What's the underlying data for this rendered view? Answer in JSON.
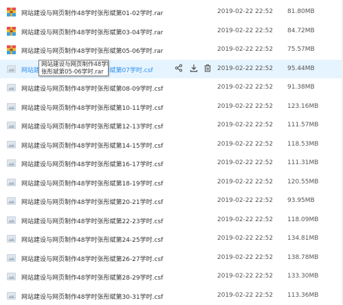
{
  "files": [
    {
      "name": "网站建设与网页制作48学时张彤斌第01-02学时.rar",
      "date": "2019-02-22 22:52",
      "size": "81.80MB",
      "icon": "rar-archive-icon"
    },
    {
      "name": "网站建设与网页制作48学时张彤斌第03-04学时.rar",
      "date": "2019-02-22 22:52",
      "size": "84.72MB",
      "icon": "rar-archive-icon"
    },
    {
      "name": "网站建设与网页制作48学时张彤斌第05-06学时.rar",
      "date": "2019-02-22 22:52",
      "size": "75.57MB",
      "icon": "rar-archive-icon"
    },
    {
      "name": "网站建设与网页制作48学时张彤斌第07学时.csf",
      "date": "2019-02-22 22:52",
      "size": "95.44MB",
      "icon": "csf-file-icon"
    },
    {
      "name": "网站建设与网页制作48学时张彤斌第08-09学时.csf",
      "date": "2019-02-22 22:52",
      "size": "91.38MB",
      "icon": "csf-file-icon"
    },
    {
      "name": "网站建设与网页制作48学时张彤斌第10-11学时.csf",
      "date": "2019-02-22 22:52",
      "size": "123.16MB",
      "icon": "csf-file-icon"
    },
    {
      "name": "网站建设与网页制作48学时张彤斌第12-13学时.csf",
      "date": "2019-02-22 22:52",
      "size": "111.57MB",
      "icon": "csf-file-icon"
    },
    {
      "name": "网站建设与网页制作48学时张彤斌第14-15学时.csf",
      "date": "2019-02-22 22:52",
      "size": "118.53MB",
      "icon": "csf-file-icon"
    },
    {
      "name": "网站建设与网页制作48学时张彤斌第16-17学时.csf",
      "date": "2019-02-22 22:52",
      "size": "111.31MB",
      "icon": "csf-file-icon"
    },
    {
      "name": "网站建设与网页制作48学时张彤斌第18-19学时.csf",
      "date": "2019-02-22 22:52",
      "size": "120.55MB",
      "icon": "csf-file-icon"
    },
    {
      "name": "网站建设与网页制作48学时张彤斌第20-21学时.csf",
      "date": "2019-02-22 22:52",
      "size": "93.95MB",
      "icon": "csf-file-icon"
    },
    {
      "name": "网站建设与网页制作48学时张彤斌第22-23学时.csf",
      "date": "2019-02-22 22:52",
      "size": "118.09MB",
      "icon": "csf-file-icon"
    },
    {
      "name": "网站建设与网页制作48学时张彤斌第24-25学时.csf",
      "date": "2019-02-22 22:52",
      "size": "134.81MB",
      "icon": "csf-file-icon"
    },
    {
      "name": "网站建设与网页制作48学时张彤斌第26-27学时.csf",
      "date": "2019-02-22 22:52",
      "size": "138.78MB",
      "icon": "csf-file-icon"
    },
    {
      "name": "网站建设与网页制作48学时张彤斌第28-29学时.csf",
      "date": "2019-02-22 22:52",
      "size": "133.30MB",
      "icon": "csf-file-icon"
    },
    {
      "name": "网站建设与网页制作48学时张彤斌第30-31学时.csf",
      "date": "2019-02-22 22:52",
      "size": "113.36MB",
      "icon": "csf-file-icon"
    }
  ],
  "hovered_row": 3,
  "tooltip": {
    "line1": "网站建设与网页制作48学时",
    "line2": "张彤斌第05-06学时.rar"
  },
  "row_actions": [
    {
      "label": "share",
      "icon": "share-icon"
    },
    {
      "label": "download",
      "icon": "download-icon"
    },
    {
      "label": "delete",
      "icon": "trash-icon"
    }
  ],
  "colors": {
    "hover_bg": "#e6f4ff",
    "hover_text": "#2e8ff0",
    "text": "#333333",
    "meta_text": "#555555"
  }
}
